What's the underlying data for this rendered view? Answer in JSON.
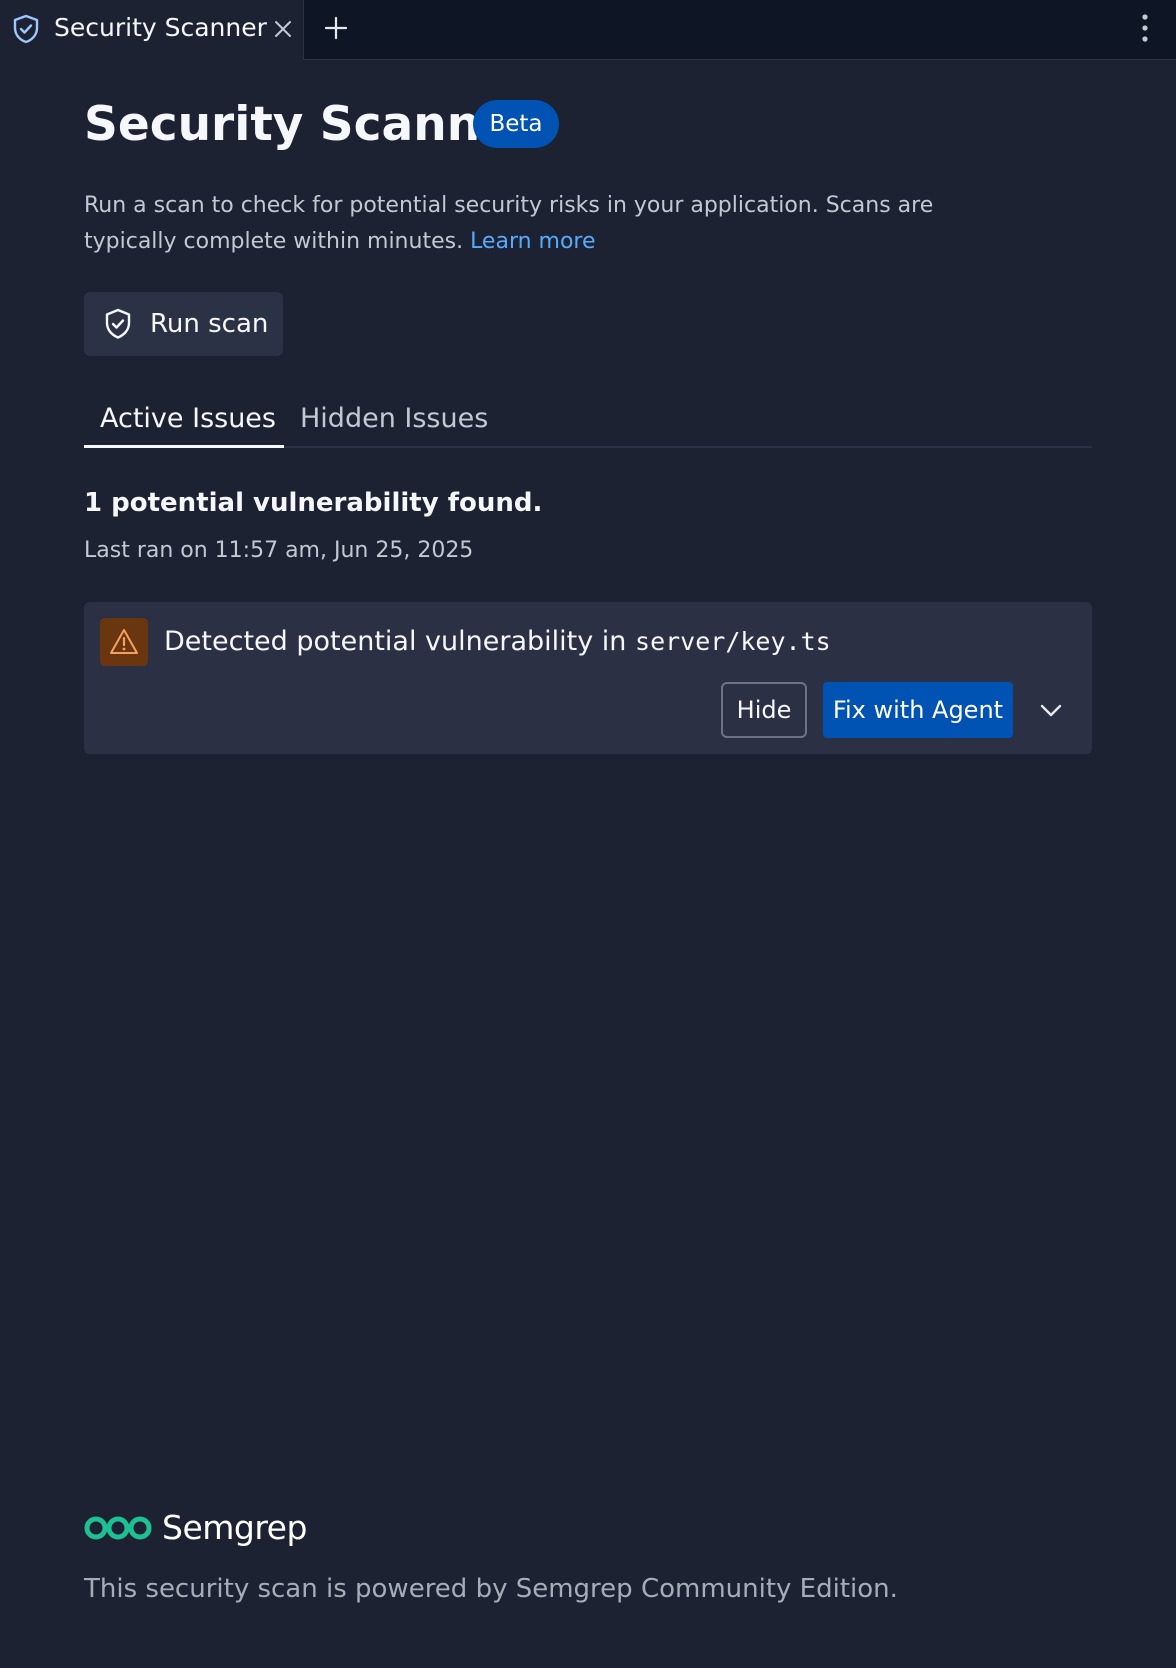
{
  "tabbar": {
    "tab_title": "Security Scanner",
    "tab_icon": "shield-icon",
    "close_icon": "close-icon",
    "new_tab_icon": "plus-icon",
    "menu_icon": "kebab-menu-icon"
  },
  "header": {
    "title": "Security Scanner",
    "badge": "Beta",
    "description": "Run a scan to check for potential security risks in your application. Scans are typically complete within minutes.",
    "learn_more": "Learn more"
  },
  "actions": {
    "run_scan_label": "Run scan",
    "run_scan_icon": "shield-check-icon"
  },
  "tabs": [
    {
      "label": "Active Issues",
      "active": true
    },
    {
      "label": "Hidden Issues",
      "active": false
    }
  ],
  "results": {
    "summary": "1 potential vulnerability found.",
    "last_ran": "Last ran on 11:57 am, Jun 25, 2025"
  },
  "issues": [
    {
      "icon": "warning-icon",
      "text": "Detected potential vulnerability in",
      "path": "server/key.ts",
      "hide_label": "Hide",
      "fix_label": "Fix with Agent",
      "expand_icon": "chevron-down-icon"
    }
  ],
  "footer": {
    "logo_text": "Semgrep",
    "note": "This security scan is powered by Semgrep Community Edition."
  },
  "colors": {
    "background": "#1c2232",
    "tabbar": "#0e1525",
    "accent": "#0053b3",
    "link": "#57abff",
    "warning_bg": "#6a3610",
    "warning_fg": "#f5a15b",
    "semgrep_green": "#1fbf94"
  }
}
